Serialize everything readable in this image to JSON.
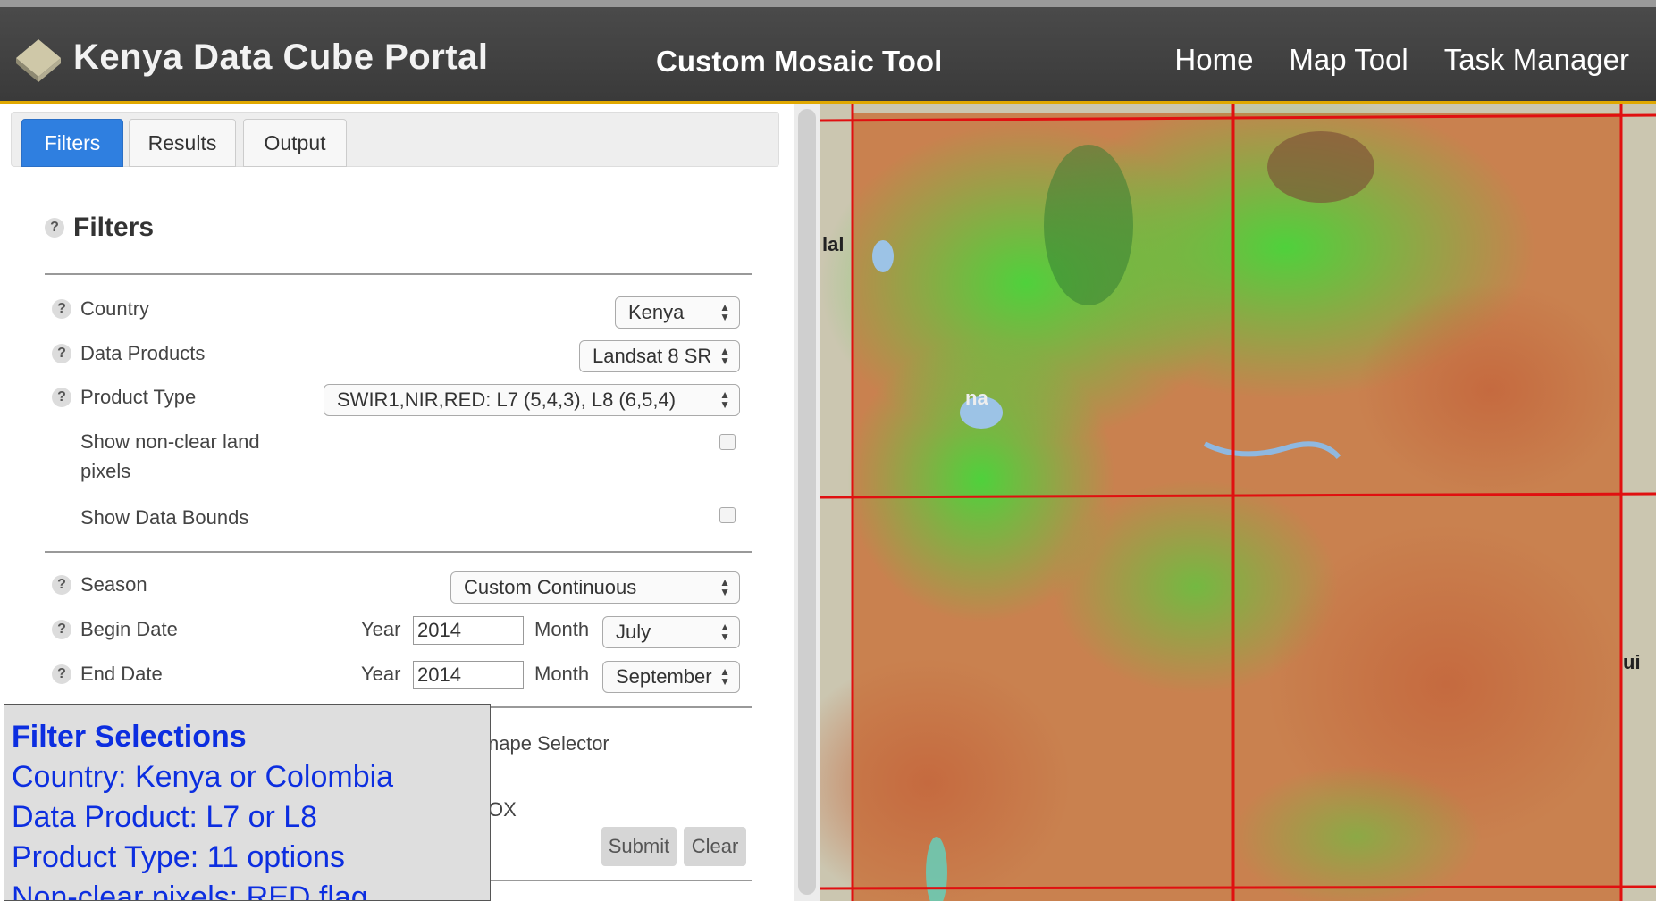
{
  "header": {
    "brand": "Kenya Data Cube Portal",
    "tool_title": "Custom Mosaic Tool",
    "nav": [
      "Home",
      "Map Tool",
      "Task Manager"
    ]
  },
  "tabs": [
    "Filters",
    "Results",
    "Output"
  ],
  "active_tab": "Filters",
  "filters": {
    "section_title": "Filters",
    "help_glyph": "?",
    "country": {
      "label": "Country",
      "value": "Kenya"
    },
    "data_products": {
      "label": "Data Products",
      "value": "Landsat 8 SR"
    },
    "product_type": {
      "label": "Product Type",
      "value": "SWIR1,NIR,RED: L7 (5,4,3), L8 (6,5,4)"
    },
    "non_clear": {
      "label": "Show non-clear land pixels",
      "checked": false
    },
    "data_bounds": {
      "label": "Show Data Bounds",
      "checked": false
    },
    "season": {
      "label": "Season",
      "value": "Custom Continuous"
    },
    "begin_date": {
      "label": "Begin Date",
      "year_label": "Year",
      "year": "2014",
      "month_label": "Month",
      "month": "July"
    },
    "end_date": {
      "label": "End Date",
      "year_label": "Year",
      "year": "2014",
      "month_label": "Month",
      "month": "September"
    },
    "shape_selector_partial": "nape Selector",
    "bbox_partial": "ox",
    "submit_label": "Submit",
    "clear_label": "Clear"
  },
  "callout": {
    "title": "Filter Selections",
    "lines": [
      "Country: Kenya or Colombia",
      "Data Product: L7 or L8",
      "Product Type: 11 options",
      "Non-clear pixels: RED flag"
    ]
  },
  "map": {
    "labels": [
      "lal",
      "na",
      "ui"
    ],
    "grid_color": "#e01010"
  },
  "colors": {
    "header_bg": "#3f3f3f",
    "accent_border": "#e0a800",
    "active_tab": "#2f7fe0",
    "callout_text": "#0c2ee0"
  }
}
